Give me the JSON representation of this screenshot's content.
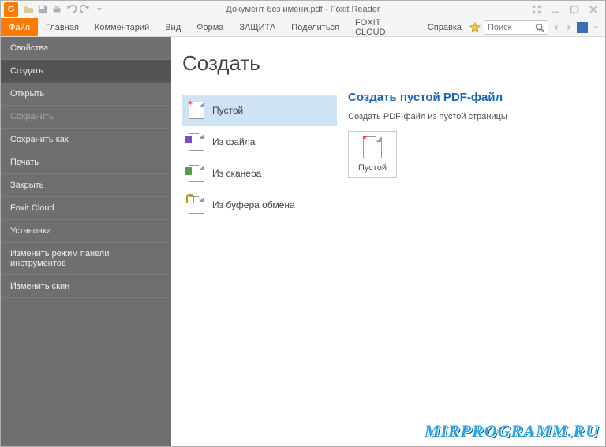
{
  "title": "Документ без имени.pdf - Foxit Reader",
  "ribbon": {
    "tabs": [
      "Файл",
      "Главная",
      "Комментарий",
      "Вид",
      "Форма",
      "ЗАЩИТА",
      "Поделиться",
      "FOXIT CLOUD",
      "Справка"
    ],
    "active_index": 0
  },
  "search": {
    "placeholder": "Поиск"
  },
  "sidebar": {
    "items": [
      {
        "label": "Свойства",
        "state": "normal"
      },
      {
        "label": "Создать",
        "state": "selected"
      },
      {
        "label": "Открыть",
        "state": "normal"
      },
      {
        "label": "Сохранить",
        "state": "disabled"
      },
      {
        "label": "Сохранить как",
        "state": "normal"
      },
      {
        "label": "Печать",
        "state": "normal"
      },
      {
        "label": "Закрыть",
        "state": "normal"
      },
      {
        "label": "Foxit Cloud",
        "state": "normal"
      },
      {
        "label": "Установки",
        "state": "normal"
      },
      {
        "label": "Изменить режим панели инструментов",
        "state": "normal"
      },
      {
        "label": "Изменить скин",
        "state": "normal"
      }
    ]
  },
  "page": {
    "heading": "Создать",
    "options": [
      {
        "label": "Пустой",
        "icon": "blank",
        "selected": true
      },
      {
        "label": "Из файла",
        "icon": "file",
        "selected": false
      },
      {
        "label": "Из сканера",
        "icon": "scanner",
        "selected": false
      },
      {
        "label": "Из буфера обмена",
        "icon": "clipboard",
        "selected": false
      }
    ]
  },
  "detail": {
    "title": "Создать пустой PDF-файл",
    "desc": "Создать PDF-файл из пустой страницы",
    "tile_label": "Пустой"
  },
  "watermark": "MIRPROGRAMM.RU"
}
